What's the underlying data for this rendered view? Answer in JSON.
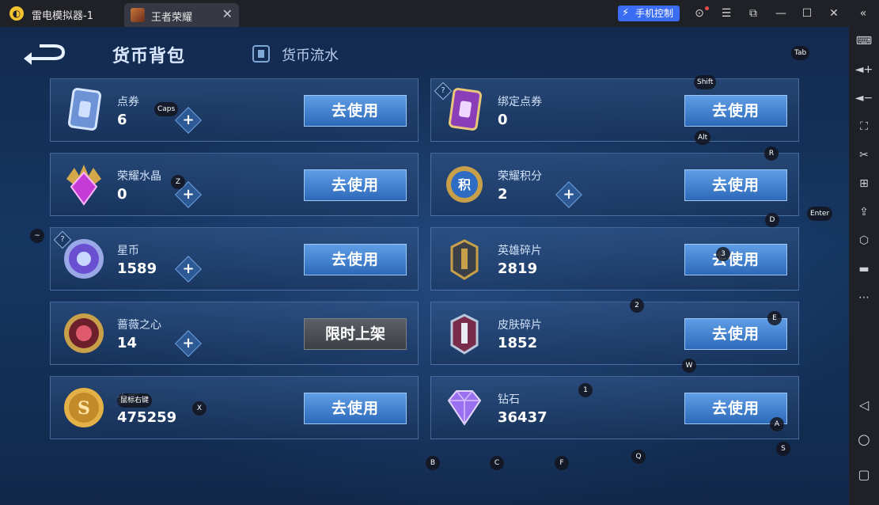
{
  "titlebar": {
    "app_title": "雷电模拟器-1",
    "tab_label": "王者荣耀",
    "tab_close": "✕",
    "phone_control": "手机控制",
    "controls": [
      {
        "name": "account-icon",
        "glyph": "⊙"
      },
      {
        "name": "menu-icon",
        "glyph": "☰"
      },
      {
        "name": "restore-icon",
        "glyph": "⧉"
      },
      {
        "name": "minimize-icon",
        "glyph": "—"
      },
      {
        "name": "maximize-icon",
        "glyph": "☐"
      },
      {
        "name": "close-icon",
        "glyph": "✕"
      },
      {
        "name": "collapse-sidebar-icon",
        "glyph": "«"
      }
    ]
  },
  "sidebar": {
    "icons": [
      {
        "name": "keyboard-icon",
        "glyph": "⌨"
      },
      {
        "name": "volume-up-icon",
        "glyph": "🔊"
      },
      {
        "name": "volume-down-icon",
        "glyph": "🔉"
      },
      {
        "name": "fullscreen-icon",
        "glyph": "⛶"
      },
      {
        "name": "scissors-icon",
        "glyph": "✂"
      },
      {
        "name": "add-window-icon",
        "glyph": "⊞"
      },
      {
        "name": "apk-install-icon",
        "glyph": "⇪"
      },
      {
        "name": "hexagon-settings-icon",
        "glyph": "⬡"
      },
      {
        "name": "folder-icon",
        "glyph": "▬"
      },
      {
        "name": "more-icon",
        "glyph": "⋯"
      },
      {
        "name": "android-back-icon",
        "glyph": "◁"
      },
      {
        "name": "android-home-icon",
        "glyph": "○"
      },
      {
        "name": "android-recents-icon",
        "glyph": "▢"
      }
    ]
  },
  "game": {
    "tab_active": "货币背包",
    "tab_inactive": "货币流水",
    "use_label": "去使用",
    "limited_label": "限时上架",
    "qmark": "?",
    "plus": "+",
    "cards": [
      {
        "name": "点券",
        "amount": "6",
        "icon": "voucher-card-icon",
        "plus": true
      },
      {
        "name": "绑定点券",
        "amount": "0",
        "icon": "bound-voucher-card-icon",
        "plus": false
      },
      {
        "name": "荣耀水晶",
        "amount": "0",
        "icon": "glory-crystal-icon",
        "plus": true
      },
      {
        "name": "荣耀积分",
        "amount": "2",
        "icon": "glory-points-icon",
        "plus": true
      },
      {
        "name": "星币",
        "amount": "1589",
        "icon": "star-coin-icon",
        "plus": true
      },
      {
        "name": "英雄碎片",
        "amount": "2819",
        "icon": "hero-fragment-icon",
        "plus": false
      },
      {
        "name": "蔷薇之心",
        "amount": "14",
        "icon": "rose-heart-icon",
        "plus": true
      },
      {
        "name": "皮肤碎片",
        "amount": "1852",
        "icon": "skin-fragment-icon",
        "plus": false
      },
      {
        "name": "金币",
        "amount": "475259",
        "icon": "gold-coin-icon",
        "plus": false
      },
      {
        "name": "钻石",
        "amount": "36437",
        "icon": "diamond-icon",
        "plus": false
      }
    ],
    "key_hints": [
      "Tab",
      "Shift",
      "Caps",
      "Alt",
      "R",
      "Z",
      "D",
      "Enter",
      "~",
      "3",
      "2",
      "E",
      "W",
      "1",
      "鼠标右键",
      "X",
      "A",
      "B",
      "C",
      "F",
      "Q",
      "S"
    ]
  },
  "colors": {
    "titlebar_bg": "#1f2127",
    "phone_btn": "#3b6df4",
    "use_btn": "#3f80cf",
    "limited_btn": "#4a4e55"
  }
}
